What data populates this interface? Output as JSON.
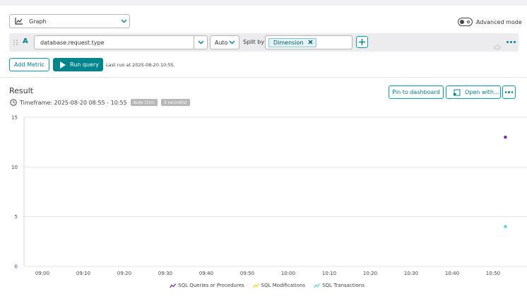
{
  "toolbar": {
    "viz_select": "Graph",
    "advanced_mode_label": "Advanced mode"
  },
  "query": {
    "letter": "A",
    "metric": "database.request.type",
    "aggregation": "Auto",
    "split_by_label": "Split by",
    "dimension_chip": "Dimension",
    "add_metric_label": "Add Metric",
    "run_query_label": "Run query",
    "last_run": "Last run at 2025-08-20 10:55."
  },
  "result": {
    "title": "Result",
    "timeframe": "Timeframe: 2025-08-20 08:55 - 10:55",
    "resolution_badge": "Auto (1m)",
    "records_badge": "3 record(s)",
    "pin_label": "Pin to dashboard",
    "open_with_label": "Open with..."
  },
  "colors": {
    "accent": "#00848e",
    "series_purple": "#6f2da8",
    "series_yellow": "#f5d30f",
    "series_cyan": "#4fd5e0"
  },
  "chart_data": {
    "type": "scatter",
    "x_ticks": [
      "09:00",
      "09:10",
      "09:20",
      "09:30",
      "09:40",
      "09:50",
      "10:00",
      "10:10",
      "10:20",
      "10:30",
      "10:40",
      "10:50"
    ],
    "y_ticks": [
      "0",
      "5",
      "10",
      "15"
    ],
    "ylim": [
      0,
      15
    ],
    "grid": true,
    "legend_position": "bottom",
    "series": [
      {
        "name": "SQL Queries or Procedures",
        "color": "#6f2da8",
        "points": [
          {
            "x": "10:53",
            "y": 13
          }
        ]
      },
      {
        "name": "SQL Modifications",
        "color": "#f5d30f",
        "points": []
      },
      {
        "name": "SQL Transactions",
        "color": "#4fd5e0",
        "points": [
          {
            "x": "10:53",
            "y": 4
          }
        ]
      }
    ]
  }
}
